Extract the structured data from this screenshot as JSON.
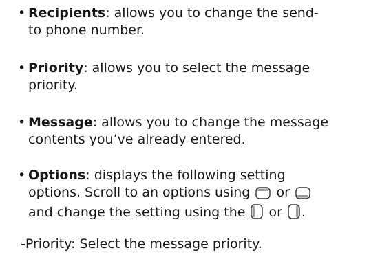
{
  "items": [
    {
      "term": "Recipients",
      "line1": ": allows you to change the send-",
      "line2": "to phone number."
    },
    {
      "term": "Priority",
      "line1": ": allows you to select the message",
      "line2": "priority."
    },
    {
      "term": "Message",
      "line1": ": allows you to change the message",
      "line2": "contents you’ve already entered."
    },
    {
      "term": "Options",
      "line1": ": displays the following setting",
      "line2a": "options. Scroll to an options using",
      "line2b": "or",
      "line3a": "and change the setting using the",
      "line3b": "or",
      "line3c": "."
    }
  ],
  "sub_item": "-Priority: Select the message priority.",
  "icons": {
    "up": "nav-up-key-icon",
    "down": "nav-down-key-icon",
    "left": "nav-left-key-icon",
    "right": "nav-right-key-icon"
  }
}
